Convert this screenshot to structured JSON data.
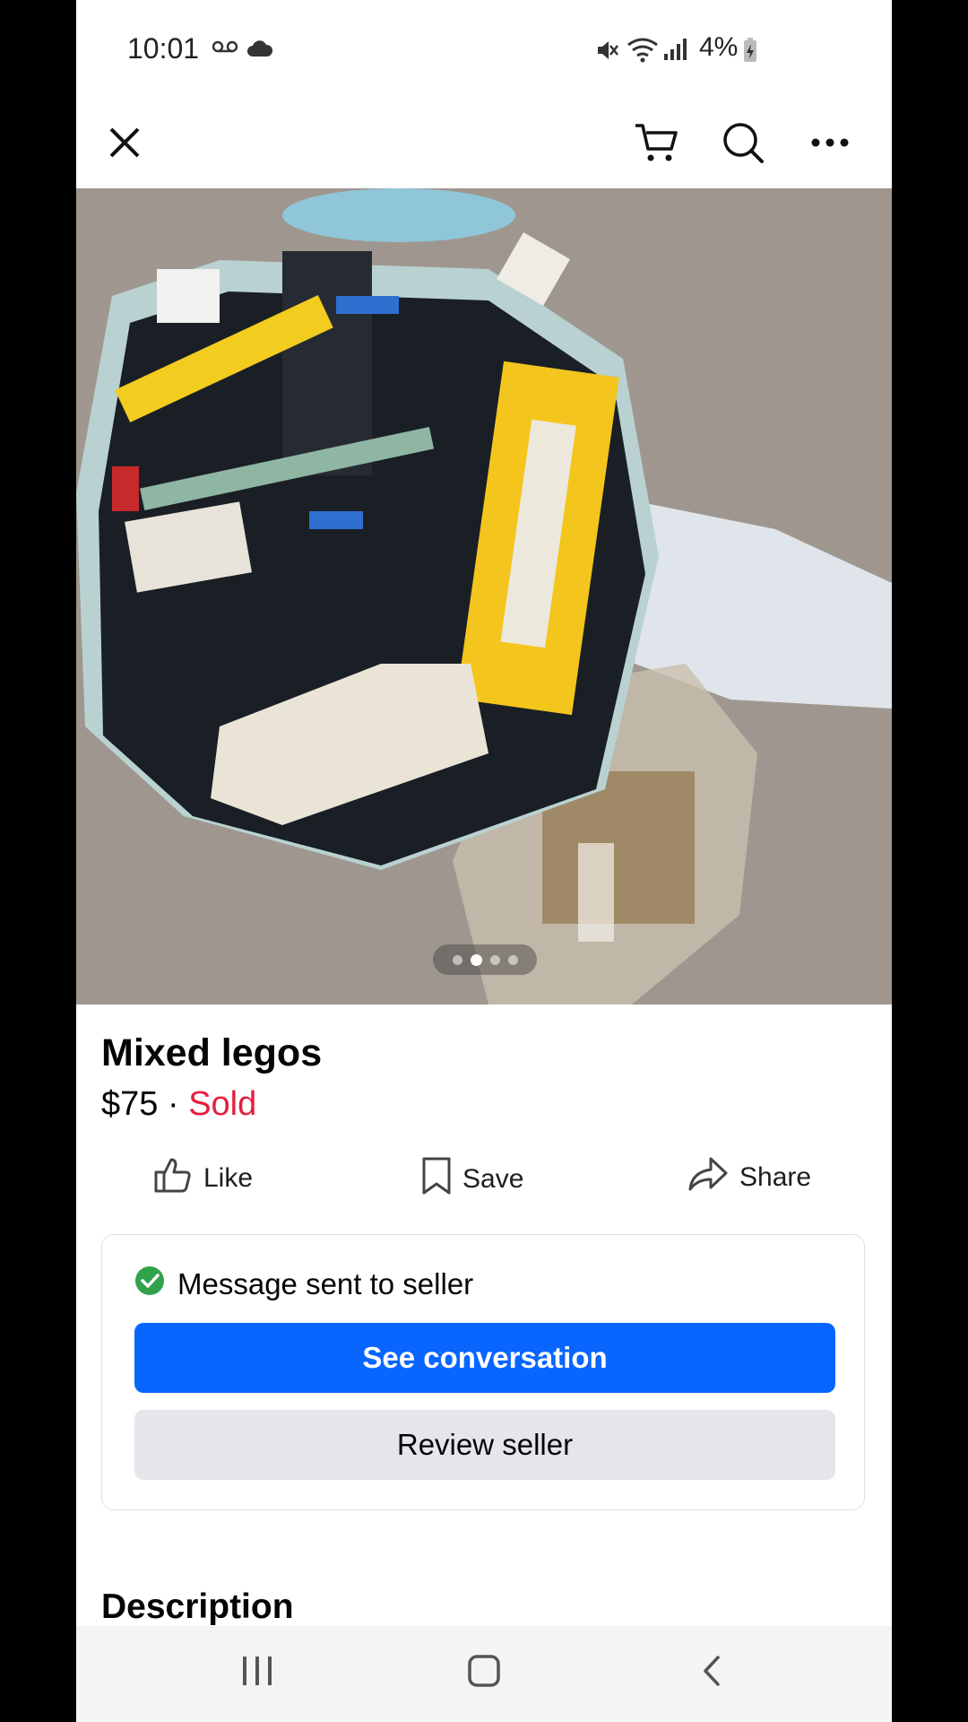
{
  "status_bar": {
    "time": "10:01",
    "battery": "4%",
    "icons": [
      "voicemail-icon",
      "cloud-icon",
      "mute-icon",
      "wifi-icon",
      "signal-icon",
      "battery-charging-icon"
    ]
  },
  "top_nav": {
    "icons": [
      "close-icon",
      "cart-icon",
      "search-icon",
      "more-icon"
    ]
  },
  "photo": {
    "page_indicator": {
      "count": 4,
      "active_index": 1
    }
  },
  "listing": {
    "title": "Mixed legos",
    "price": "$75",
    "separator": " · ",
    "status": "Sold"
  },
  "actions": {
    "like": "Like",
    "save": "Save",
    "share": "Share"
  },
  "message_card": {
    "status": "Message sent to seller",
    "see_conversation": "See conversation",
    "review_seller": "Review seller"
  },
  "description_heading": "Description",
  "colors": {
    "accent": "#0866ff",
    "sold": "#e41e3f",
    "success": "#31a24c",
    "secondary_button": "#e4e6eb"
  },
  "android_nav": {
    "icons": [
      "recents-icon",
      "home-icon",
      "back-icon"
    ]
  }
}
